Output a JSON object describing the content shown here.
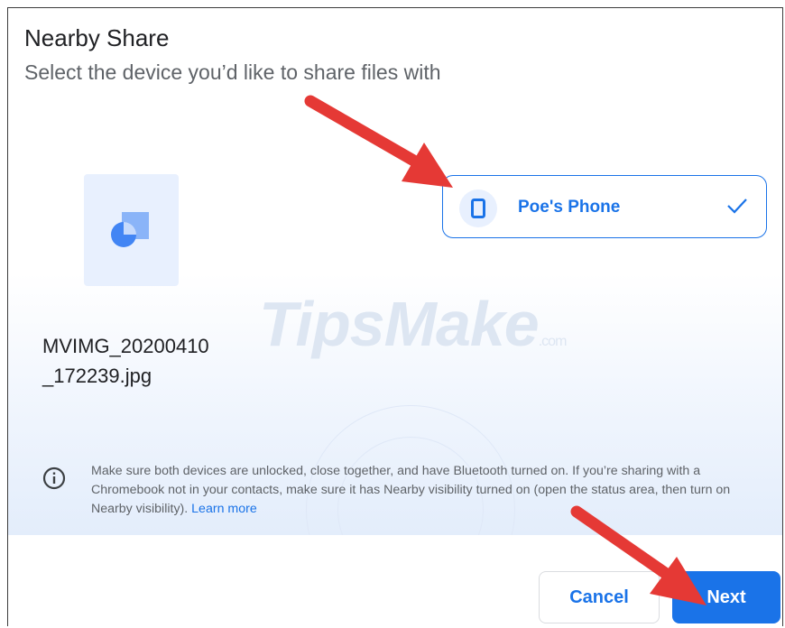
{
  "dialog": {
    "title": "Nearby Share",
    "subtitle": "Select the device you’d like to share files with"
  },
  "file": {
    "name_line1": "MVIMG_20200410",
    "name_line2": "_172239.jpg",
    "thumbnail_icon": "image-file-icon"
  },
  "device": {
    "name": "Poe's Phone",
    "icon": "phone-icon",
    "selected": true,
    "status_icon": "check-icon"
  },
  "watermark": {
    "text": "TipsMake",
    "suffix": ".com"
  },
  "info": {
    "icon": "info-icon",
    "text": "Make sure both devices are unlocked, close together, and have Bluetooth turned on. If you’re sharing with a Chromebook not in your contacts, make sure it has Nearby visibility turned on (open the status area, then turn on Nearby visibility). ",
    "link_label": "Learn more"
  },
  "buttons": {
    "cancel_label": "Cancel",
    "next_label": "Next"
  },
  "colors": {
    "accent": "#1a73e8",
    "annotation_arrow": "#e53935"
  }
}
